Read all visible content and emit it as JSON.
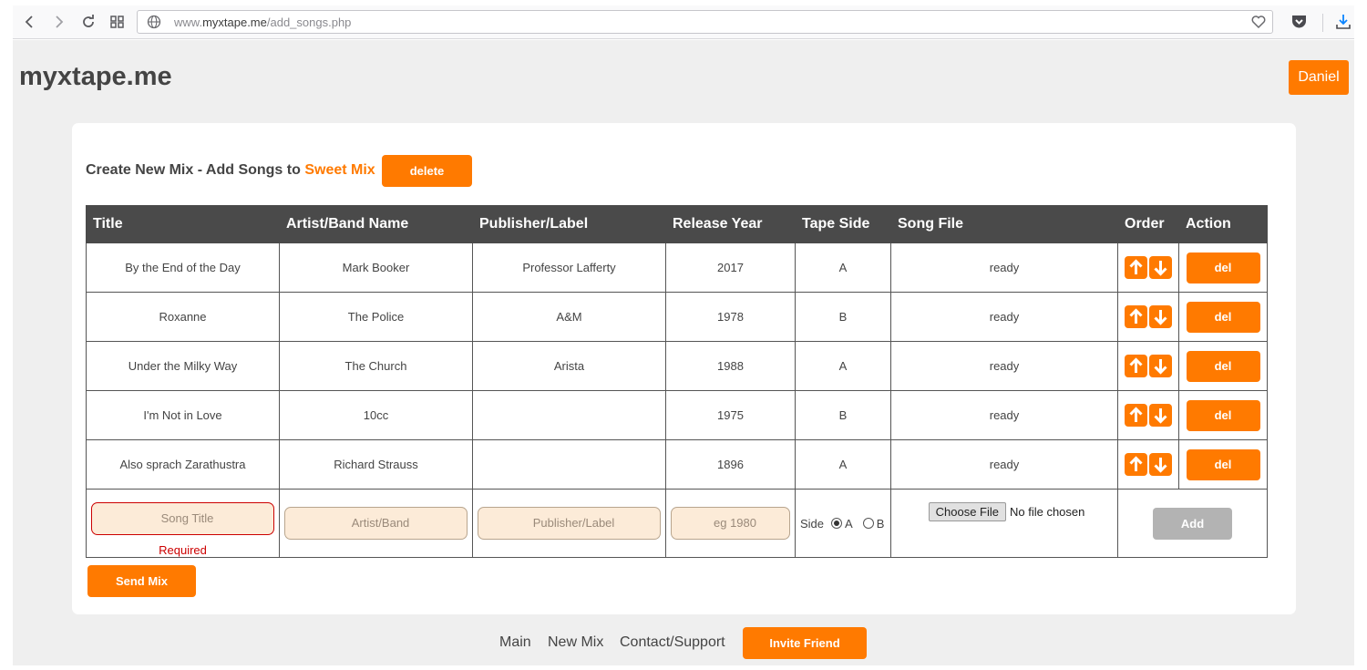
{
  "browser": {
    "url_prefix": "www.",
    "url_domain": "myxtape.me",
    "url_path": "/add_songs.php"
  },
  "header": {
    "logo": "myxtape.me",
    "user": "Daniel"
  },
  "mix": {
    "heading_prefix": "Create New Mix - Add Songs to",
    "name": "Sweet Mix",
    "delete_label": "delete"
  },
  "table": {
    "columns": [
      "Title",
      "Artist/Band Name",
      "Publisher/Label",
      "Release Year",
      "Tape Side",
      "Song File",
      "Order",
      "Action"
    ],
    "rows": [
      {
        "title": "By the End of the Day",
        "artist": "Mark Booker",
        "publisher": "Professor Lafferty",
        "year": "2017",
        "side": "A",
        "file": "ready",
        "action": "del"
      },
      {
        "title": "Roxanne",
        "artist": "The Police",
        "publisher": "A&M",
        "year": "1978",
        "side": "B",
        "file": "ready",
        "action": "del"
      },
      {
        "title": "Under the Milky Way",
        "artist": "The Church",
        "publisher": "Arista",
        "year": "1988",
        "side": "A",
        "file": "ready",
        "action": "del"
      },
      {
        "title": "I'm Not in Love",
        "artist": "10cc",
        "publisher": "",
        "year": "1975",
        "side": "B",
        "file": "ready",
        "action": "del"
      },
      {
        "title": "Also sprach Zarathustra",
        "artist": "Richard Strauss",
        "publisher": "",
        "year": "1896",
        "side": "A",
        "file": "ready",
        "action": "del"
      }
    ]
  },
  "form": {
    "title_placeholder": "Song Title",
    "title_error": "Required",
    "artist_placeholder": "Artist/Band",
    "publisher_placeholder": "Publisher/Label",
    "year_placeholder": "eg 1980",
    "side_label": "Side",
    "side_a": "A",
    "side_b": "B",
    "side_selected": "A",
    "choose_file": "Choose File",
    "file_status": "No file chosen",
    "add_label": "Add"
  },
  "send_label": "Send Mix",
  "footer": {
    "main": "Main",
    "new_mix": "New Mix",
    "contact": "Contact/Support",
    "invite": "Invite Friend"
  },
  "colors": {
    "accent": "#ff7a00",
    "header_bg": "#4a4a4a",
    "input_bg": "#fcebd8",
    "error": "#cc0000"
  }
}
